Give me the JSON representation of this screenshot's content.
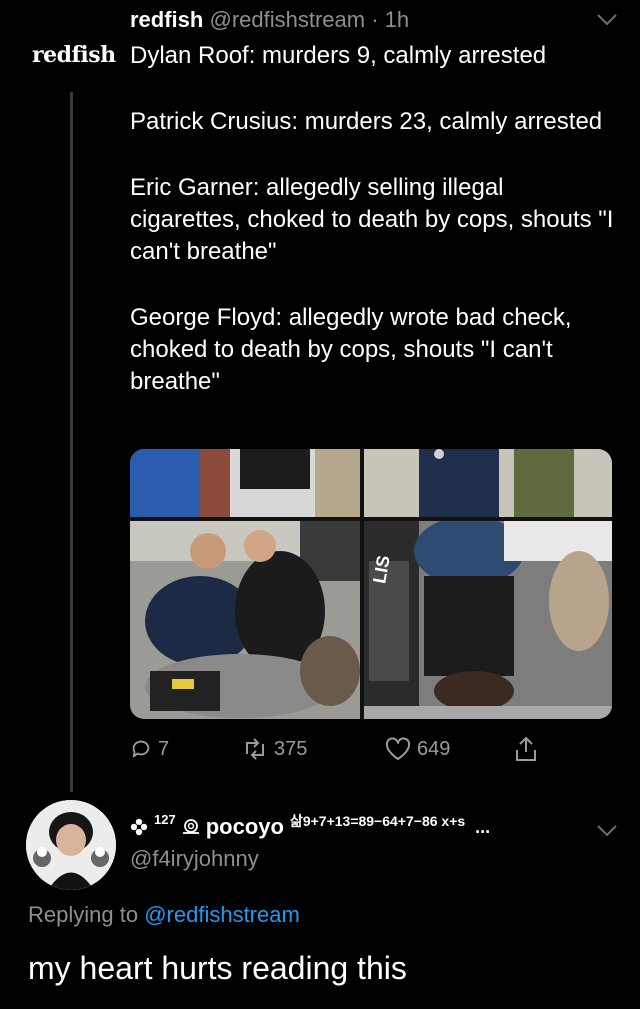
{
  "tweet": {
    "logo_text": "redfish",
    "name": "redfish",
    "handle": "@redfishstream",
    "separator": "·",
    "time": "1h",
    "paragraphs": [
      "Dylan Roof: murders 9, calmly arrested",
      "Patrick Crusius: murders 23, calmly arrested",
      "Eric Garner: allegedly selling illegal cigarettes, choked to death by cops, shouts \"I can't breathe\"",
      "George Floyd: allegedly wrote bad check, choked to death by cops, shouts \"I can't breathe\""
    ],
    "media_overlay_text": "LIS",
    "actions": {
      "replies": "7",
      "retweets": "375",
      "likes": "649"
    }
  },
  "reply": {
    "badge_count": "127",
    "name": "pocoyo",
    "name_suffix": "삶9+7+13=89−64+7−86 x+s",
    "ellipsis": "...",
    "handle": "@f4iryjohnny",
    "replying_prefix": "Replying to",
    "replying_to": "@redfishstream",
    "text": "my heart hurts reading this"
  },
  "colors": {
    "background": "#000000",
    "text": "#ffffff",
    "secondary": "#8e8e93",
    "link": "#1d9bf0",
    "thread_line": "#3a3a3c"
  }
}
